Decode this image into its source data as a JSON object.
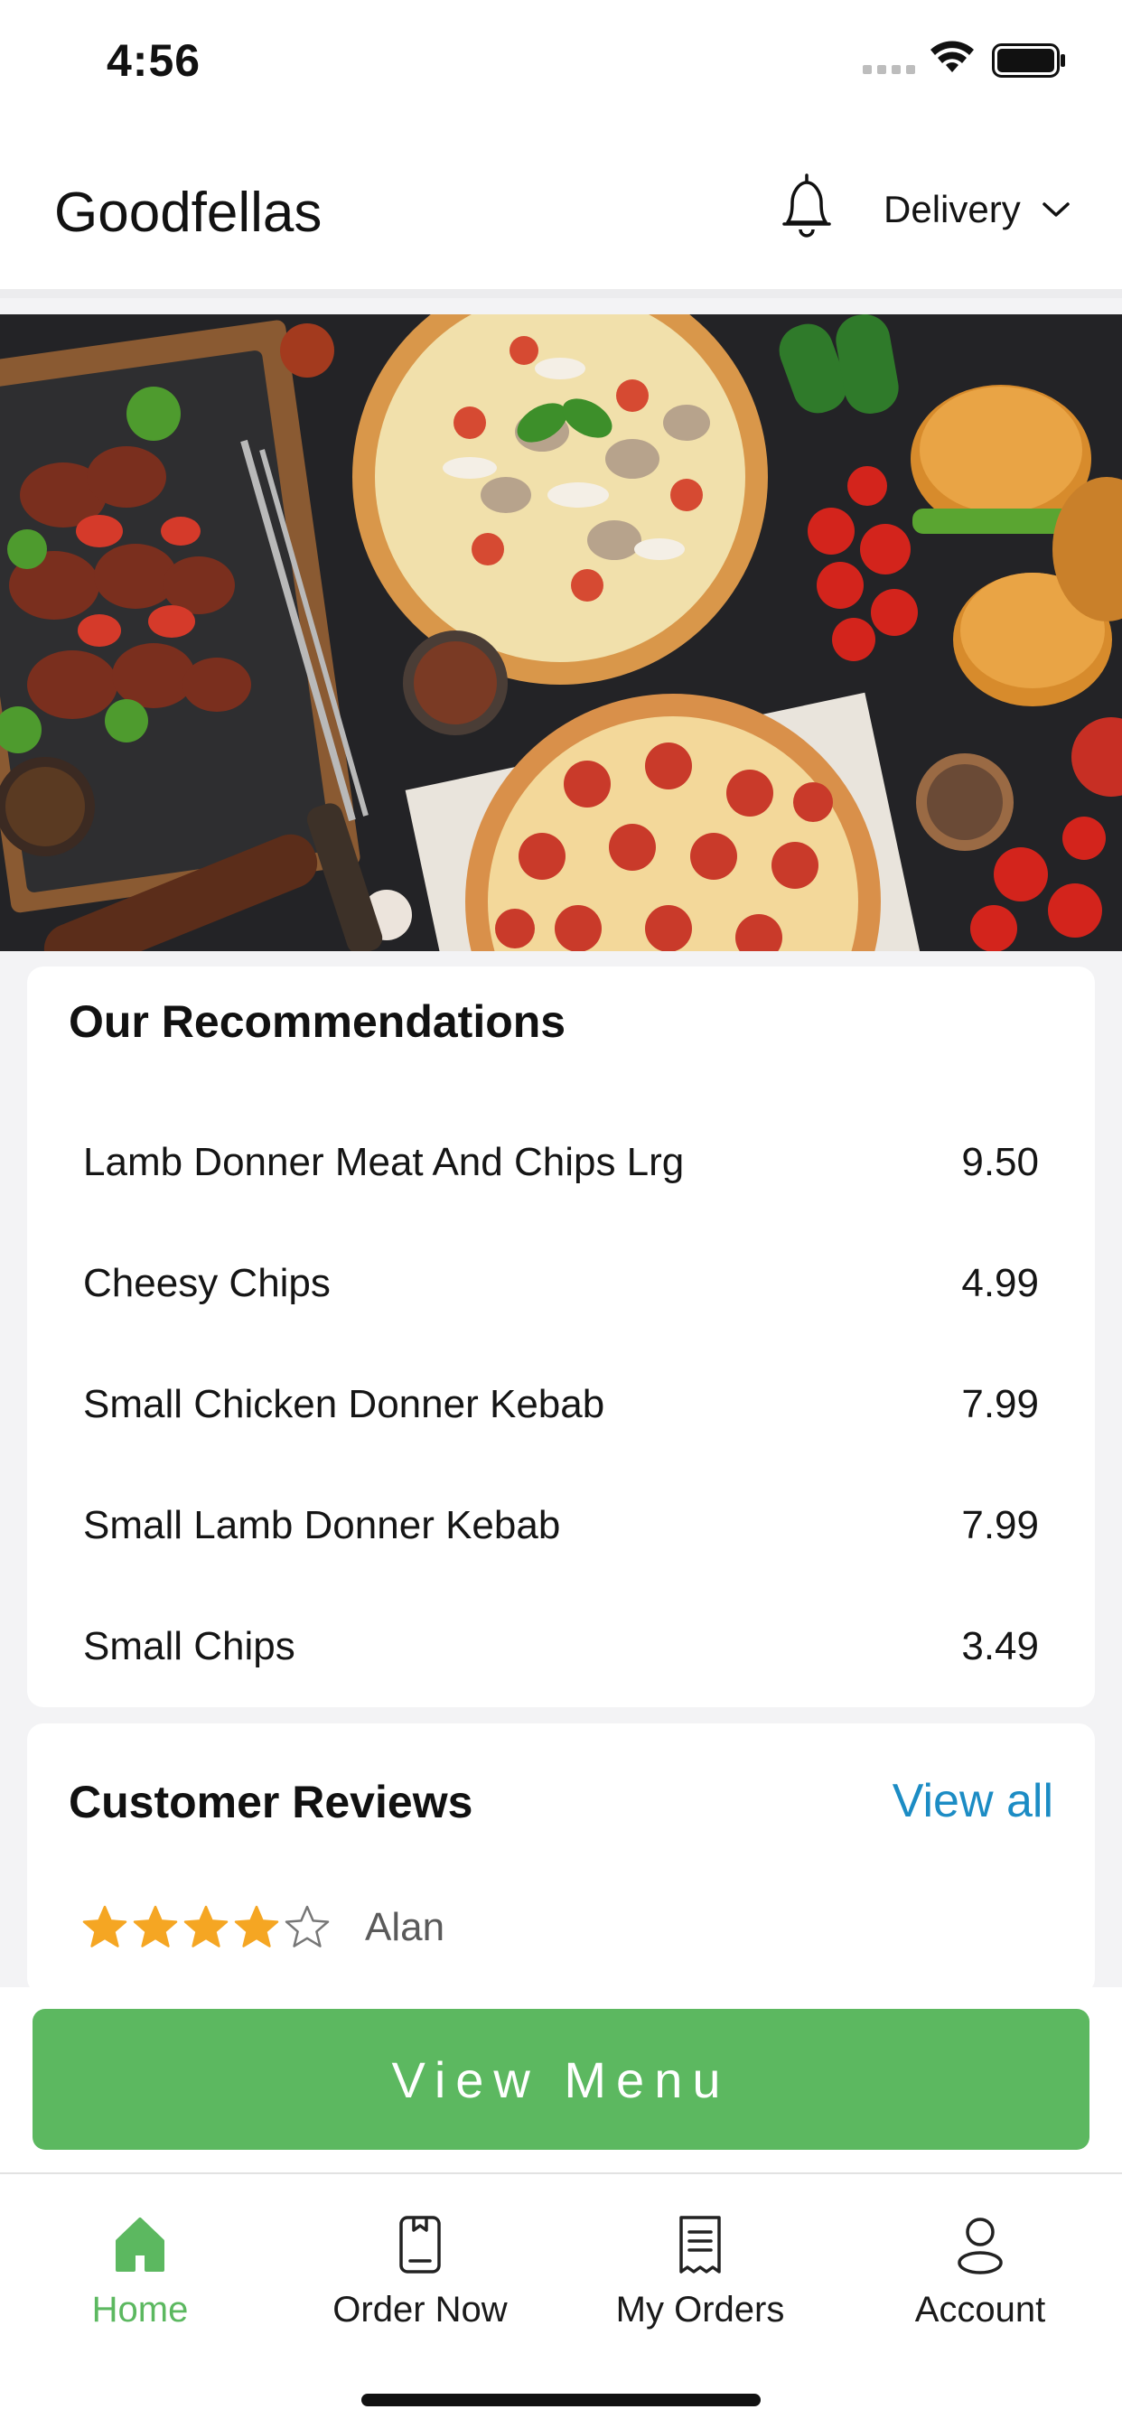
{
  "status_bar": {
    "time": "4:56"
  },
  "header": {
    "title": "Goodfellas",
    "bell_icon": "bell-icon",
    "mode_selector": "Delivery"
  },
  "recommendations": {
    "title": "Our Recommendations",
    "items": [
      {
        "name": "Lamb Donner Meat And Chips Lrg",
        "price": "9.50"
      },
      {
        "name": "Cheesy Chips",
        "price": "4.99"
      },
      {
        "name": "Small Chicken Donner Kebab",
        "price": "7.99"
      },
      {
        "name": "Small Lamb Donner Kebab",
        "price": "7.99"
      },
      {
        "name": "Small Chips",
        "price": "3.49"
      }
    ]
  },
  "reviews": {
    "title": "Customer Reviews",
    "view_all": "View all",
    "items": [
      {
        "reviewer": "Alan",
        "rating": 4,
        "max_rating": 5
      }
    ]
  },
  "cta": {
    "label": "View Menu"
  },
  "tabs": [
    {
      "label": "Home",
      "icon": "home-icon",
      "active": true
    },
    {
      "label": "Order Now",
      "icon": "order-icon",
      "active": false
    },
    {
      "label": "My Orders",
      "icon": "receipt-icon",
      "active": false
    },
    {
      "label": "Account",
      "icon": "user-icon",
      "active": false
    }
  ],
  "colors": {
    "accent_green": "#5cb860",
    "link_blue": "#1c8cc4",
    "star_gold": "#f5a623"
  }
}
